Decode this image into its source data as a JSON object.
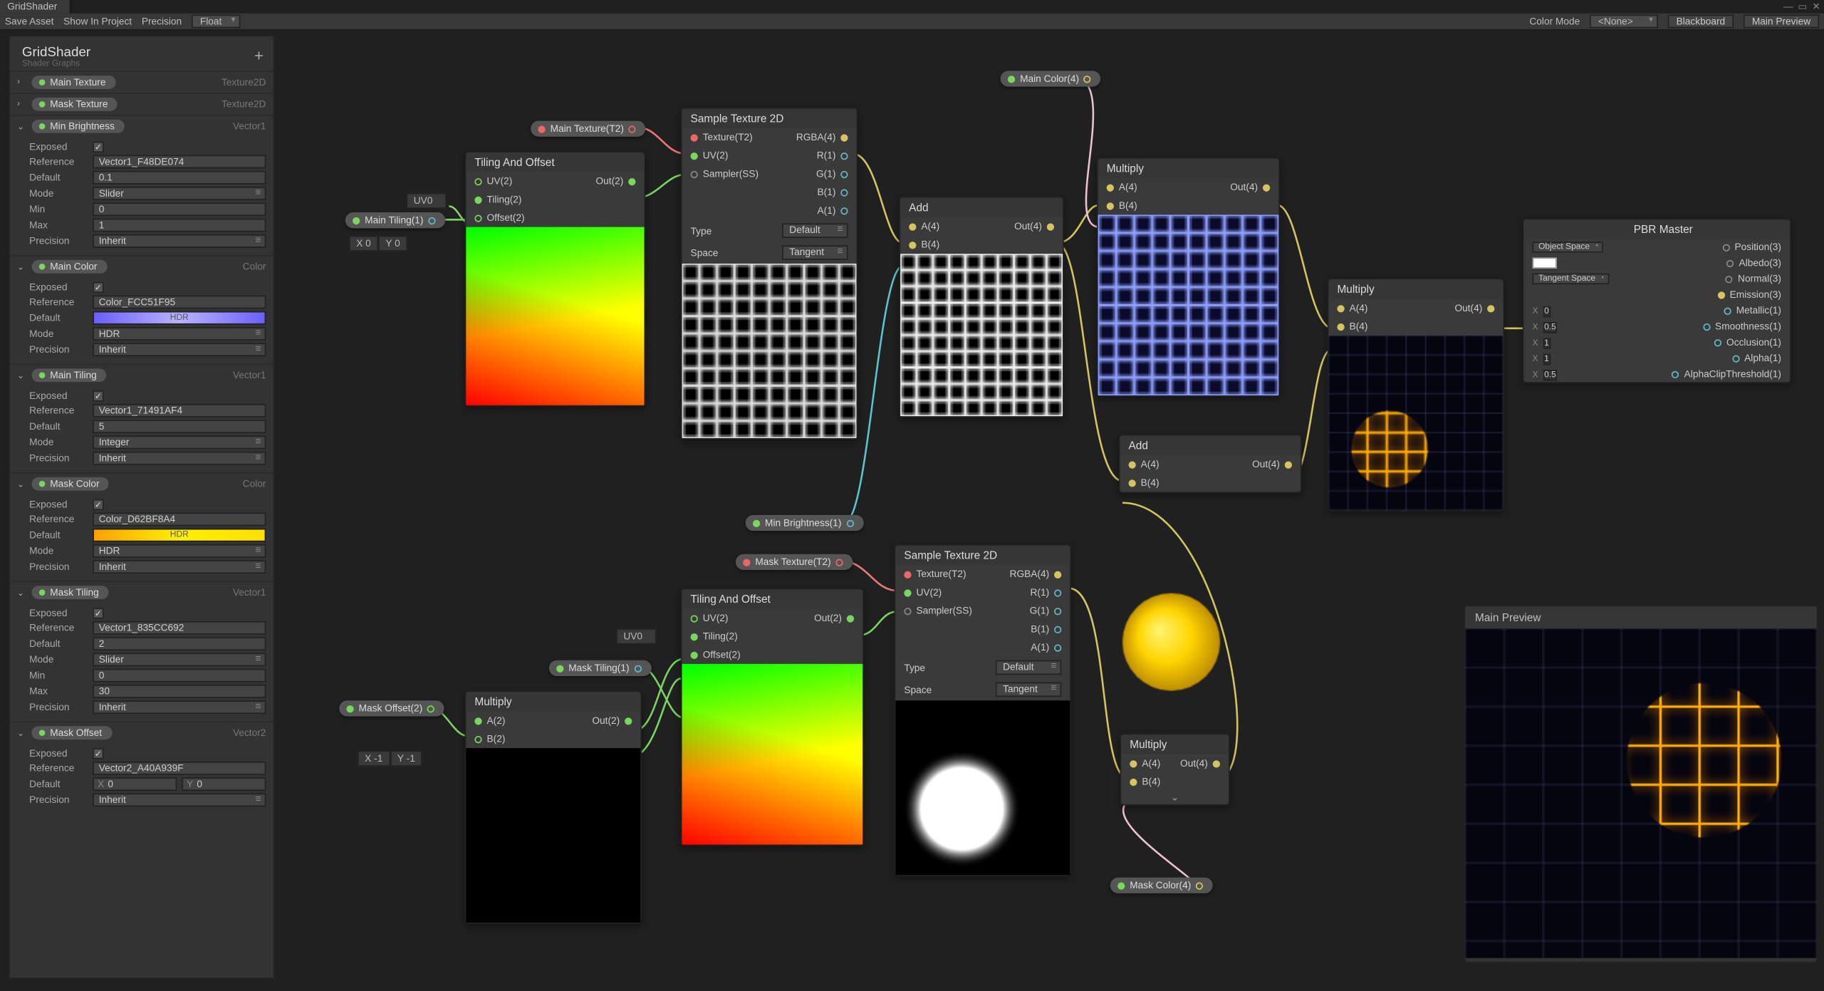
{
  "window": {
    "title": "GridShader"
  },
  "tab": "GridShader",
  "toolbar": {
    "save": "Save Asset",
    "show": "Show In Project",
    "precision": "Precision",
    "precisionVal": "Float",
    "colorMode": "Color Mode",
    "colorModeVal": "<None>",
    "blackboard": "Blackboard",
    "mainPreview": "Main Preview"
  },
  "blackboard": {
    "title": "GridShader",
    "subtitle": "Shader Graphs",
    "add": "+",
    "props": [
      {
        "name": "Main Texture",
        "type": "Texture2D",
        "dot": "green",
        "open": false
      },
      {
        "name": "Mask Texture",
        "type": "Texture2D",
        "dot": "green",
        "open": false
      },
      {
        "name": "Min Brightness",
        "type": "Vector1",
        "dot": "green",
        "open": true,
        "fields": [
          {
            "k": "Exposed",
            "v": "check"
          },
          {
            "k": "Reference",
            "v": "Vector1_F48DE074"
          },
          {
            "k": "Default",
            "v": "0.1"
          },
          {
            "k": "Mode",
            "v": "Slider",
            "dd": true
          },
          {
            "k": "Min",
            "v": "0"
          },
          {
            "k": "Max",
            "v": "1"
          },
          {
            "k": "Precision",
            "v": "Inherit",
            "dd": true
          }
        ]
      },
      {
        "name": "Main Color",
        "type": "Color",
        "dot": "green",
        "open": true,
        "fields": [
          {
            "k": "Exposed",
            "v": "check"
          },
          {
            "k": "Reference",
            "v": "Color_FCC51F95"
          },
          {
            "k": "Default",
            "v": "swatch-purple"
          },
          {
            "k": "Mode",
            "v": "HDR",
            "dd": true
          },
          {
            "k": "Precision",
            "v": "Inherit",
            "dd": true
          }
        ]
      },
      {
        "name": "Main Tiling",
        "type": "Vector1",
        "dot": "green",
        "open": true,
        "fields": [
          {
            "k": "Exposed",
            "v": "check"
          },
          {
            "k": "Reference",
            "v": "Vector1_71491AF4"
          },
          {
            "k": "Default",
            "v": "5"
          },
          {
            "k": "Mode",
            "v": "Integer",
            "dd": true
          },
          {
            "k": "Precision",
            "v": "Inherit",
            "dd": true
          }
        ]
      },
      {
        "name": "Mask Color",
        "type": "Color",
        "dot": "green",
        "open": true,
        "fields": [
          {
            "k": "Exposed",
            "v": "check"
          },
          {
            "k": "Reference",
            "v": "Color_D62BF8A4"
          },
          {
            "k": "Default",
            "v": "swatch-yellow"
          },
          {
            "k": "Mode",
            "v": "HDR",
            "dd": true
          },
          {
            "k": "Precision",
            "v": "Inherit",
            "dd": true
          }
        ]
      },
      {
        "name": "Mask Tiling",
        "type": "Vector1",
        "dot": "green",
        "open": true,
        "fields": [
          {
            "k": "Exposed",
            "v": "check"
          },
          {
            "k": "Reference",
            "v": "Vector1_835CC692"
          },
          {
            "k": "Default",
            "v": "2"
          },
          {
            "k": "Mode",
            "v": "Slider",
            "dd": true
          },
          {
            "k": "Min",
            "v": "0"
          },
          {
            "k": "Max",
            "v": "30"
          },
          {
            "k": "Precision",
            "v": "Inherit",
            "dd": true
          }
        ]
      },
      {
        "name": "Mask Offset",
        "type": "Vector2",
        "dot": "green",
        "open": true,
        "fields": [
          {
            "k": "Exposed",
            "v": "check"
          },
          {
            "k": "Reference",
            "v": "Vector2_A40A939F"
          },
          {
            "k": "Default",
            "v": "vec2",
            "x": "0",
            "y": "0"
          },
          {
            "k": "Precision",
            "v": "Inherit",
            "dd": true
          }
        ]
      }
    ]
  },
  "nodes": {
    "tiling1": {
      "title": "Tiling And Offset",
      "uv": "UV(2)",
      "tiling": "Tiling(2)",
      "offset": "Offset(2)",
      "out": "Out(2)"
    },
    "tiling2": {
      "title": "Tiling And Offset",
      "uv": "UV(2)",
      "tiling": "Tiling(2)",
      "offset": "Offset(2)",
      "out": "Out(2)"
    },
    "sample1": {
      "title": "Sample Texture 2D",
      "tex": "Texture(T2)",
      "uv": "UV(2)",
      "samp": "Sampler(SS)",
      "rgba": "RGBA(4)",
      "r": "R(1)",
      "g": "G(1)",
      "b": "B(1)",
      "a": "A(1)",
      "type": "Type",
      "typeV": "Default",
      "space": "Space",
      "spaceV": "Tangent"
    },
    "sample2": {
      "title": "Sample Texture 2D",
      "tex": "Texture(T2)",
      "uv": "UV(2)",
      "samp": "Sampler(SS)",
      "rgba": "RGBA(4)",
      "r": "R(1)",
      "g": "G(1)",
      "b": "B(1)",
      "a": "A(1)",
      "type": "Type",
      "typeV": "Default",
      "space": "Space",
      "spaceV": "Tangent"
    },
    "add1": {
      "title": "Add",
      "a": "A(4)",
      "b": "B(4)",
      "out": "Out(4)"
    },
    "add2": {
      "title": "Add",
      "a": "A(4)",
      "b": "B(4)",
      "out": "Out(4)"
    },
    "mul1": {
      "title": "Multiply",
      "a": "A(4)",
      "b": "B(4)",
      "out": "Out(4)"
    },
    "mul2": {
      "title": "Multiply",
      "a": "A(4)",
      "b": "B(4)",
      "out": "Out(4)"
    },
    "mul3": {
      "title": "Multiply",
      "a": "A(4)",
      "b": "B(4)",
      "out": "Out(4)"
    },
    "mul4": {
      "title": "Multiply",
      "a": "A(2)",
      "b": "B(2)",
      "out": "Out(2)"
    },
    "pbr": {
      "title": "PBR Master",
      "pos": "Position(3)",
      "albedo": "Albedo(3)",
      "normal": "Normal(3)",
      "emission": "Emission(3)",
      "metallic": "Metallic(1)",
      "smooth": "Smoothness(1)",
      "occ": "Occlusion(1)",
      "alpha": "Alpha(1)",
      "clip": "AlphaClipThreshold(1)",
      "objspace": "Object Space",
      "tanspace": "Tangent Space",
      "metV": "0",
      "smV": "0.5",
      "occV": "1",
      "alV": "1",
      "clV": "0.5"
    }
  },
  "pills": {
    "mainTex": "Main Texture(T2)",
    "mainTiling": "Main Tiling(1)",
    "minBright": "Min Brightness(1)",
    "mainColor": "Main Color(4)",
    "maskTex": "Mask Texture(T2)",
    "maskTiling": "Mask Tiling(1)",
    "maskOffset": "Mask Offset(2)",
    "maskColor": "Mask Color(4)"
  },
  "uvdd": "UV0",
  "vec1": {
    "x": "0",
    "y": "0"
  },
  "vec2": {
    "x": "-1",
    "y": "-1"
  },
  "preview": "Main Preview",
  "xlab": "X",
  "ylab": "Y"
}
